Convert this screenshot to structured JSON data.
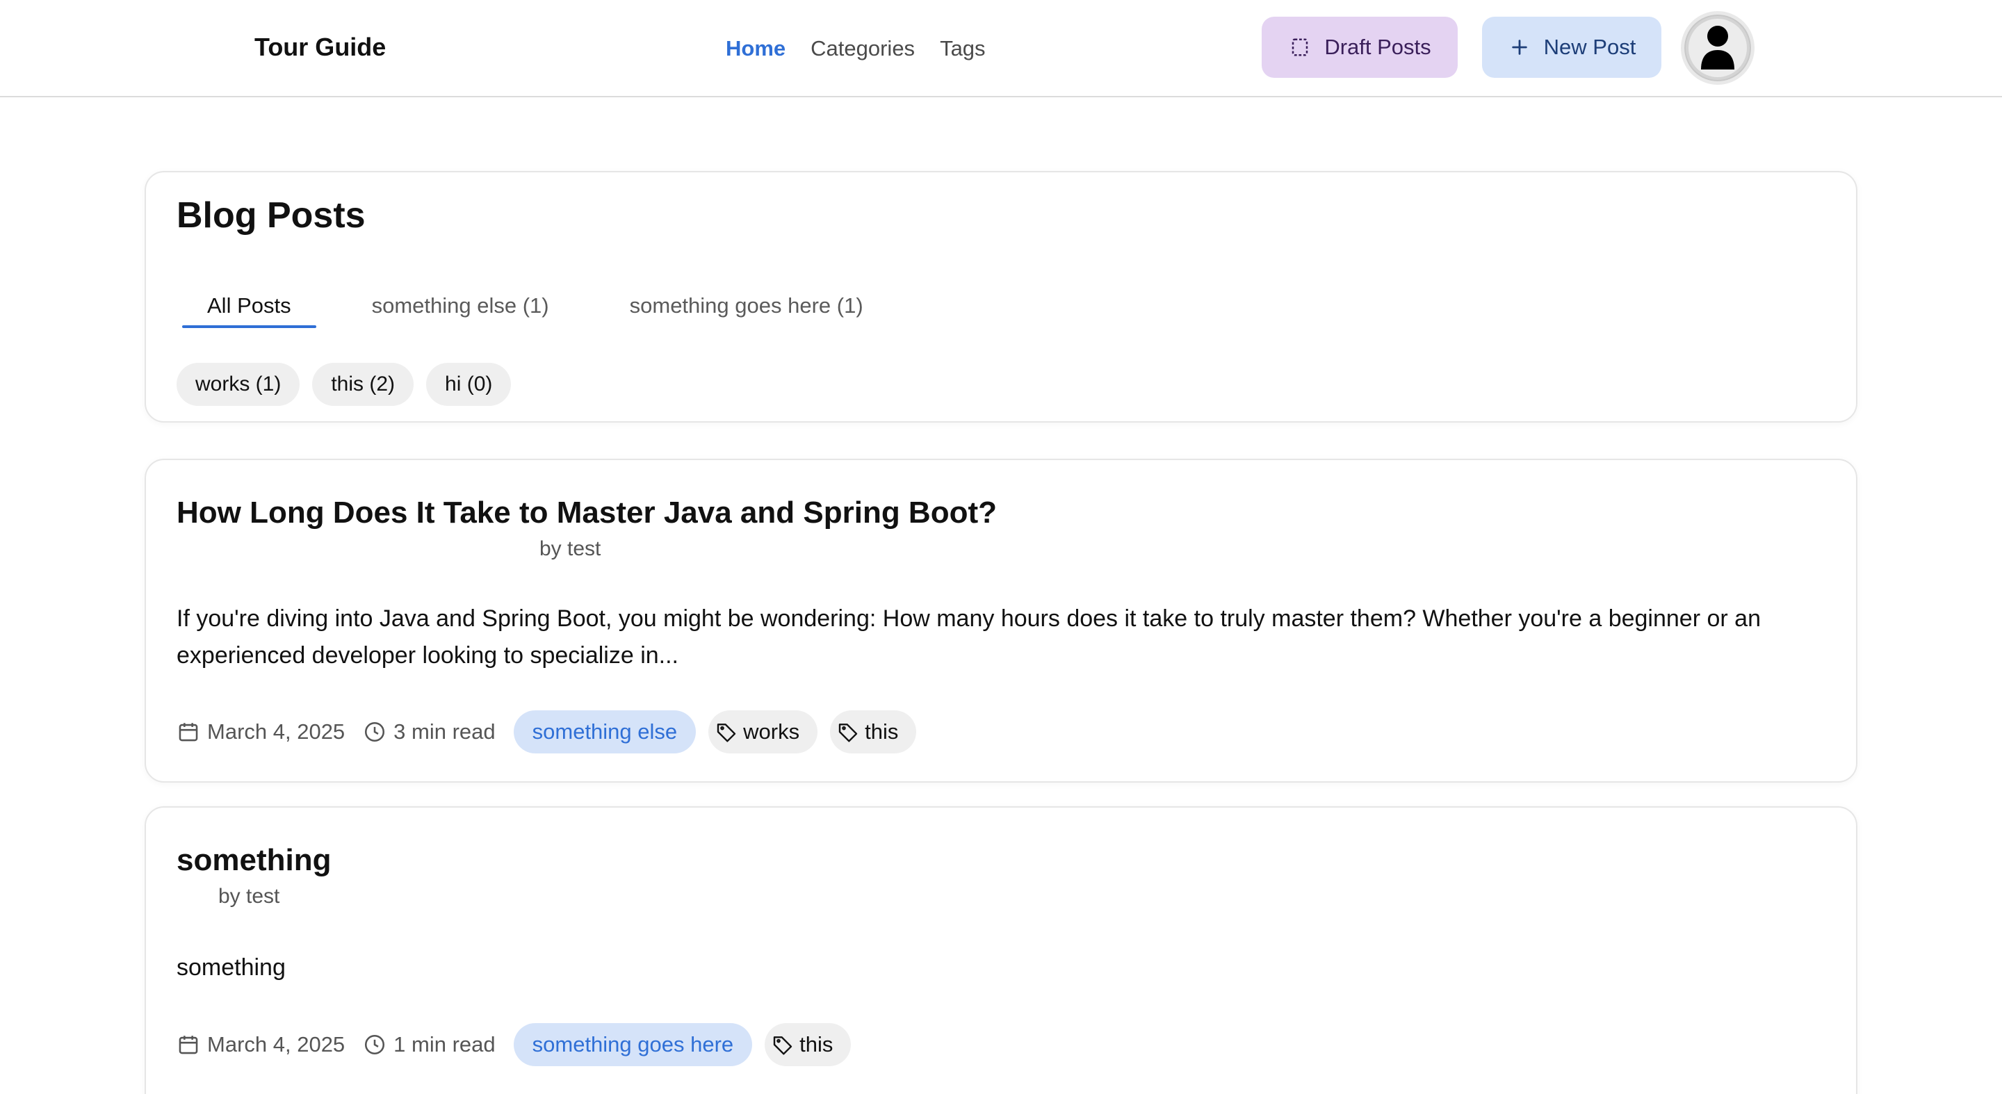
{
  "header": {
    "brand": "Tour Guide",
    "nav": [
      {
        "label": "Home",
        "active": true
      },
      {
        "label": "Categories",
        "active": false
      },
      {
        "label": "Tags",
        "active": false
      }
    ],
    "draft_button": "Draft Posts",
    "new_post_button": "New Post",
    "accent_color": "#2f6fd6"
  },
  "main": {
    "title": "Blog Posts",
    "tabs": [
      {
        "label": "All Posts",
        "active": true
      },
      {
        "label": "something else (1)",
        "active": false
      },
      {
        "label": "something goes here (1)",
        "active": false
      }
    ],
    "tag_filters": [
      {
        "label": "works (1)"
      },
      {
        "label": "this (2)"
      },
      {
        "label": "hi (0)"
      }
    ]
  },
  "posts": [
    {
      "title": "How Long Does It Take to Master Java and Spring Boot?",
      "author": "by test",
      "excerpt": "If you're diving into Java and Spring Boot, you might be wondering: How many hours does it take to truly master them? Whether you're a beginner or an experienced developer looking to specialize in...",
      "date": "March 4, 2025",
      "read_time": "3 min read",
      "category": "something else",
      "tags": [
        "works",
        "this"
      ]
    },
    {
      "title": "something",
      "author": "by test",
      "excerpt": "something",
      "date": "March 4, 2025",
      "read_time": "1 min read",
      "category": "something goes here",
      "tags": [
        "this"
      ]
    }
  ]
}
